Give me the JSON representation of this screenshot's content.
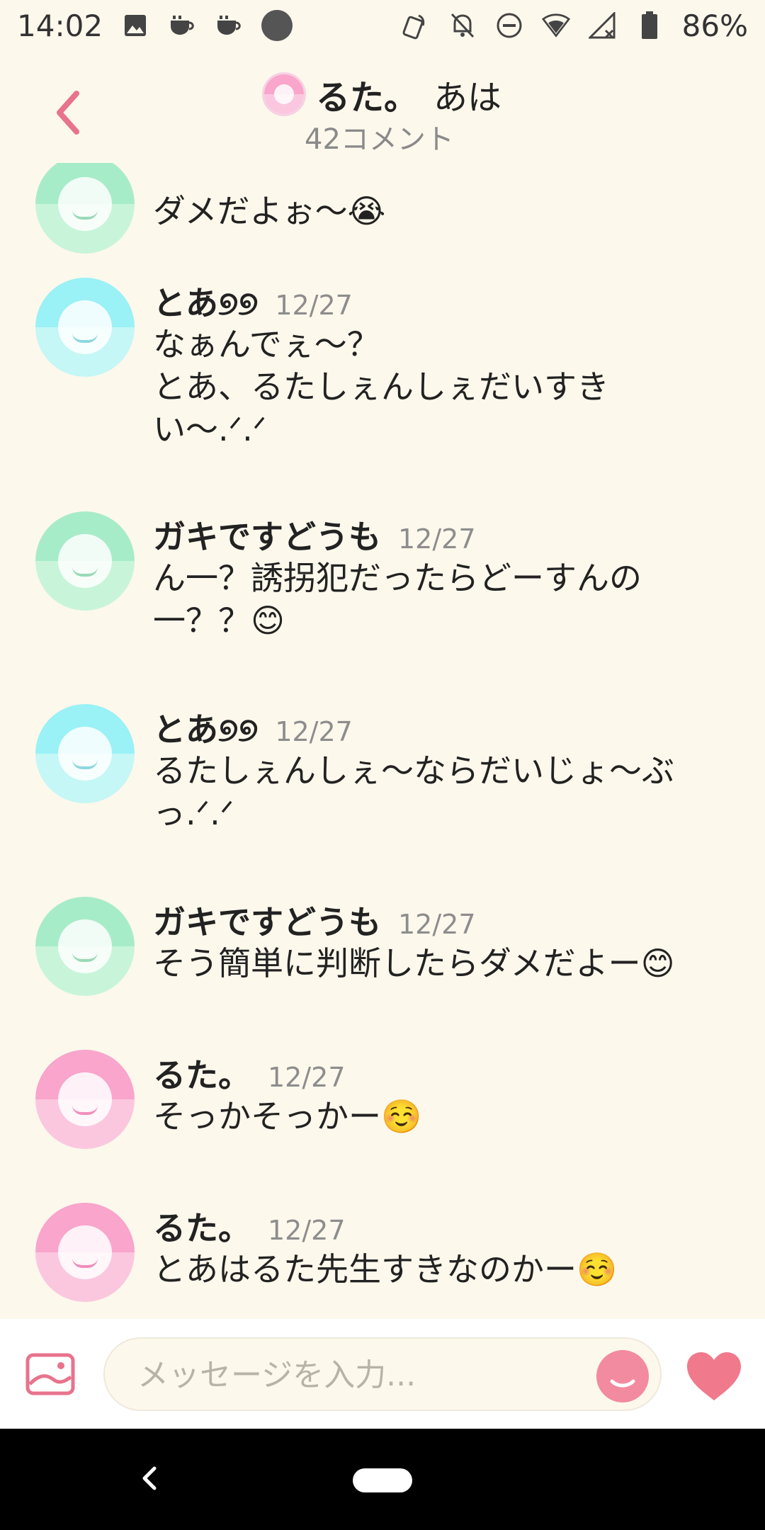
{
  "status_bar": {
    "time": "14:02",
    "battery": "86%",
    "icons_left": [
      "image-icon",
      "cup-icon",
      "cup-icon",
      "circle-icon"
    ],
    "icons_right": [
      "nfc-icon",
      "bell-off-icon",
      "dnd-icon",
      "wifi-icon",
      "signal-icon",
      "battery-icon"
    ]
  },
  "header": {
    "title_name": "るた。",
    "title_rest": "あは",
    "comment_count": "42コメント"
  },
  "messages": [
    {
      "name": "",
      "date": "",
      "text": "ダメだよぉ〜😭",
      "avatar": "green"
    },
    {
      "name": "とあ୭୭",
      "date": "12/27",
      "text": "なぁんでぇ〜？\nとあ、るたしぇんしぇだいすき\nい〜.ᐟ.ᐟ",
      "avatar": "blue"
    },
    {
      "name": "ガキですどうも",
      "date": "12/27",
      "text": "ん一？誘拐犯だったらどーすんの\n一？？😊",
      "avatar": "green"
    },
    {
      "name": "とあ୭୭",
      "date": "12/27",
      "text": "るたしぇんしぇ〜ならだいじょ〜ぶ\nっ.ᐟ.ᐟ",
      "avatar": "blue"
    },
    {
      "name": "ガキですどうも",
      "date": "12/27",
      "text": "そう簡単に判断したらダメだよー😊",
      "avatar": "green"
    },
    {
      "name": "るた。",
      "date": "12/27",
      "text": "そっかそっかー☺️",
      "avatar": "pink"
    },
    {
      "name": "るた。",
      "date": "12/27",
      "text": "とあはるた先生すきなのかー☺️",
      "avatar": "pink"
    }
  ],
  "composer": {
    "placeholder": "メッセージを入力..."
  },
  "colors": {
    "background": "#fdf8ec",
    "accent": "#e8738c",
    "heart": "#f07a8c"
  }
}
